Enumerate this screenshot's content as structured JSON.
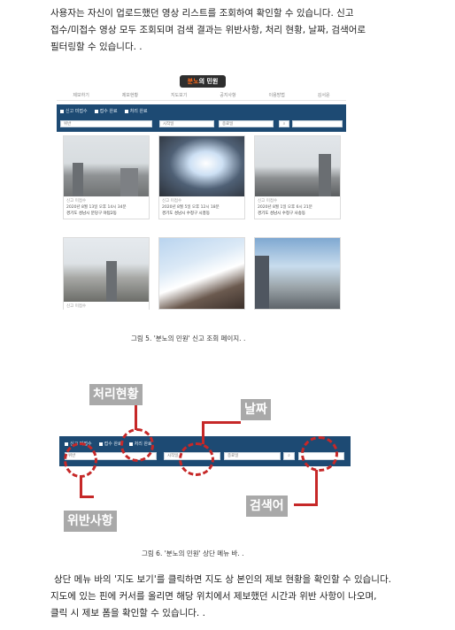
{
  "intro": {
    "line1": "사용자는 자신이 업로드했던 영상 리스트를 조회하여 확인할 수 있습니다. 신고",
    "line2": "접수/미접수 영상 모두 조회되며 검색 결과는 위반사항, 처리 현황, 날짜, 검색어로",
    "line3": "필터링할 수 있습니다. ."
  },
  "screen1": {
    "logo_prefix": "분노",
    "logo_rest": "의 민원",
    "nav": [
      "제보하기",
      "제보현황",
      "지도보기",
      "공지사항",
      "이용방법",
      "김서윤"
    ],
    "checkboxes": [
      "신고 미접수",
      "접수 완료",
      "처리 완료"
    ],
    "violation_select": "위반",
    "start_date": "시작일",
    "end_date": "종료일",
    "cards": [
      {
        "status": "신고 미접수",
        "date": "2020년 8월 13일 오후 14시 34분",
        "location": "경기도 성남시 분당구 야탑2동"
      },
      {
        "status": "신고 미접수",
        "date": "2020년 8월 5일 오후 12시 18분",
        "location": "경기도 성남시 수정구 시흥동"
      },
      {
        "status": "신고 미접수",
        "date": "2020년 8월 1일 오후 6시 21분",
        "location": "경기도 성남시 수정구 사송동"
      },
      {
        "status": "신고 미접수",
        "date": "",
        "location": ""
      },
      {
        "status": "",
        "date": "",
        "location": ""
      },
      {
        "status": "",
        "date": "",
        "location": ""
      }
    ]
  },
  "caption1": "그림 5. '분노의 민원' 신고 조회 페이지. .",
  "screen2": {
    "checkboxes": [
      "신고 미접수",
      "접수 완료",
      "처리 완료"
    ],
    "violation_select": "위반",
    "start_date": "시작일",
    "end_date": "종료일",
    "labels": {
      "status": "처리현황",
      "date": "날짜",
      "violation": "위반사항",
      "search": "검색어"
    }
  },
  "caption2": "그림 6. '분노의 민원' 상단 메뉴 바. .",
  "outro": {
    "line1": "상단 메뉴 바의 '지도 보기'를 클릭하면 지도 상 본인의 제보 현황을 확인할 수 있습니다.",
    "line2": "지도에 있는 핀에 커서를 올리면 해당 위치에서 제보했던 시간과 위반 사항이 나오며,",
    "line3": "클릭 시 제보 폼을 확인할 수 있습니다. ."
  },
  "colors": {
    "navy": "#1d4a73",
    "highlight": "#c62828",
    "tag": "#a9a9a9"
  }
}
